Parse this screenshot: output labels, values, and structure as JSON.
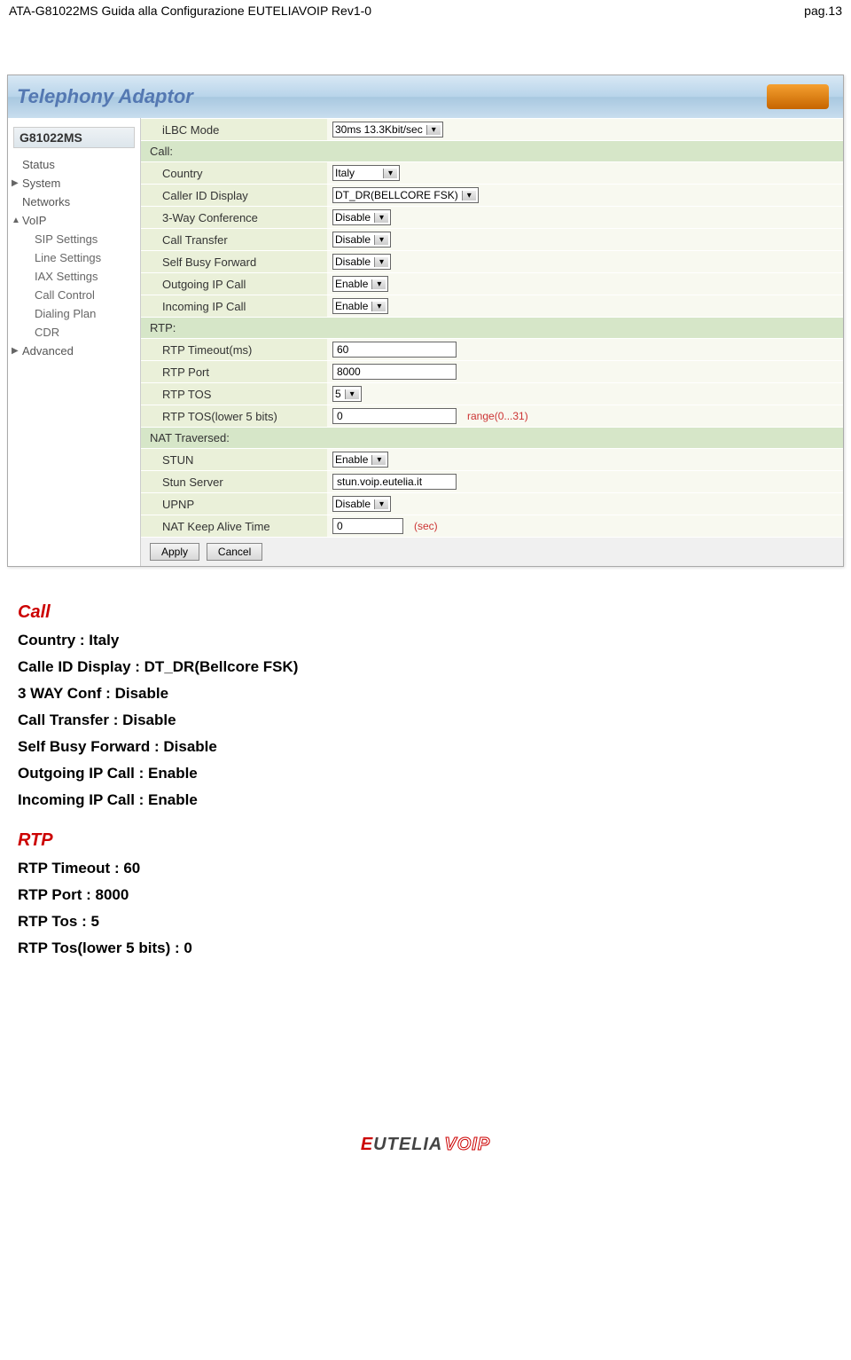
{
  "page": {
    "header_left": "ATA-G81022MS Guida alla Configurazione EUTELIAVOIP Rev1-0",
    "header_right": "pag.13"
  },
  "banner": {
    "title": "Telephony Adaptor"
  },
  "sidebar": {
    "model": "G81022MS",
    "items": [
      {
        "label": "Status",
        "top": true
      },
      {
        "label": "System",
        "top": true,
        "marker": "▶"
      },
      {
        "label": "Networks",
        "top": true
      },
      {
        "label": "VoIP",
        "top": true,
        "marker": "▲"
      },
      {
        "label": "SIP Settings",
        "sub": true
      },
      {
        "label": "Line Settings",
        "sub": true
      },
      {
        "label": "IAX Settings",
        "sub": true
      },
      {
        "label": "Call Control",
        "sub": true
      },
      {
        "label": "Dialing Plan",
        "sub": true
      },
      {
        "label": "CDR",
        "sub": true
      },
      {
        "label": "Advanced",
        "top": true,
        "marker": "▶"
      }
    ]
  },
  "form": {
    "ilbc_mode": {
      "label": "iLBC Mode",
      "value": "30ms 13.3Kbit/sec"
    },
    "call_section": "Call:",
    "country": {
      "label": "Country",
      "value": "Italy"
    },
    "caller_id": {
      "label": "Caller ID Display",
      "value": "DT_DR(BELLCORE FSK)"
    },
    "three_way": {
      "label": "3-Way Conference",
      "value": "Disable"
    },
    "call_transfer": {
      "label": "Call Transfer",
      "value": "Disable"
    },
    "self_busy": {
      "label": "Self Busy Forward",
      "value": "Disable"
    },
    "outgoing_ip": {
      "label": "Outgoing IP Call",
      "value": "Enable"
    },
    "incoming_ip": {
      "label": "Incoming IP Call",
      "value": "Enable"
    },
    "rtp_section": "RTP:",
    "rtp_timeout": {
      "label": "RTP Timeout(ms)",
      "value": "60"
    },
    "rtp_port": {
      "label": "RTP Port",
      "value": "8000"
    },
    "rtp_tos": {
      "label": "RTP TOS",
      "value": "5"
    },
    "rtp_tos_lower": {
      "label": "RTP TOS(lower 5 bits)",
      "value": "0",
      "hint": "range(0...31)"
    },
    "nat_section": "NAT Traversed:",
    "stun": {
      "label": "STUN",
      "value": "Enable"
    },
    "stun_server": {
      "label": "Stun Server",
      "value": "stun.voip.eutelia.it"
    },
    "upnp": {
      "label": "UPNP",
      "value": "Disable"
    },
    "nat_keep": {
      "label": "NAT Keep Alive Time",
      "value": "0",
      "hint": "(sec)"
    }
  },
  "buttons": {
    "apply": "Apply",
    "cancel": "Cancel"
  },
  "doc": {
    "call_title": "Call",
    "call_lines": {
      "country": "Country : Italy",
      "caller_id": "Calle ID Display : DT_DR(Bellcore FSK)",
      "three_way": "3 WAY Conf : Disable",
      "transfer": "Call Transfer : Disable",
      "self_busy": "Self Busy Forward : Disable",
      "outgoing": "Outgoing IP Call : Enable",
      "incoming": "Incoming IP Call : Enable"
    },
    "rtp_title": "RTP",
    "rtp_lines": {
      "timeout": "RTP Timeout : 60",
      "port": "RTP Port : 8000",
      "tos": "RTP Tos : 5",
      "tos_lower": "RTP Tos(lower 5 bits) : 0"
    }
  },
  "logo": {
    "e": "E",
    "eut": "UTELIA",
    "voip": "VOIP"
  }
}
